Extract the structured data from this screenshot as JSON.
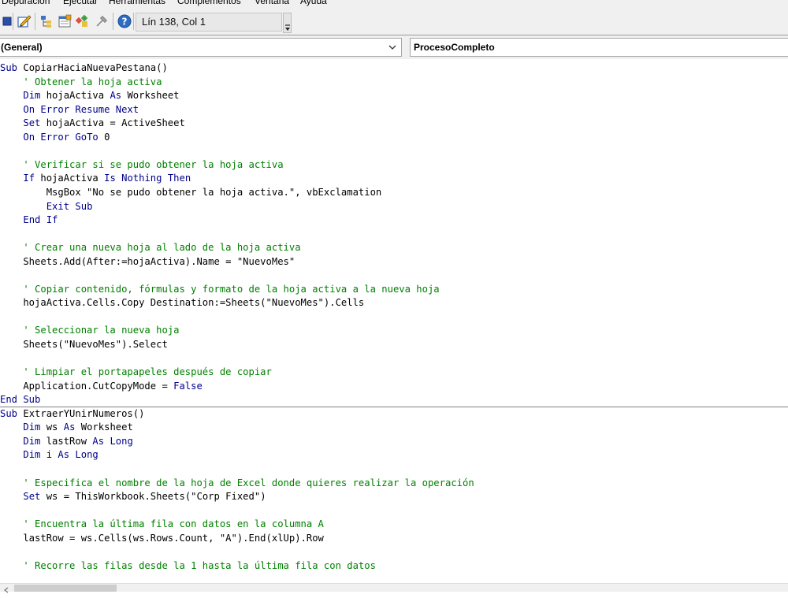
{
  "menu": {
    "items": [
      "Depuración",
      "Ejecutar",
      "Herramientas",
      "Complementos",
      "Ventana",
      "Ayuda"
    ]
  },
  "toolbar": {
    "position": "Lín 138, Col 1",
    "icons": [
      "stop-icon",
      "design-mode-icon",
      "project-explorer-icon",
      "properties-icon",
      "object-browser-icon",
      "toolbox-icon",
      "help-icon"
    ]
  },
  "combos": {
    "object": "(General)",
    "procedure": "ProcesoCompleto"
  },
  "colors": {
    "keyword": "#00008b",
    "comment": "#008000",
    "text": "#000000"
  },
  "code": {
    "lines": [
      [
        {
          "t": "Sub",
          "c": "kw"
        },
        {
          "t": " CopiarHaciaNuevaPestana()"
        }
      ],
      [
        {
          "t": "    ' Obtener la hoja activa",
          "c": "cm"
        }
      ],
      [
        {
          "t": "    "
        },
        {
          "t": "Dim",
          "c": "kw"
        },
        {
          "t": " hojaActiva "
        },
        {
          "t": "As",
          "c": "kw"
        },
        {
          "t": " Worksheet"
        }
      ],
      [
        {
          "t": "    "
        },
        {
          "t": "On Error Resume Next",
          "c": "kw"
        }
      ],
      [
        {
          "t": "    "
        },
        {
          "t": "Set",
          "c": "kw"
        },
        {
          "t": " hojaActiva = ActiveSheet"
        }
      ],
      [
        {
          "t": "    "
        },
        {
          "t": "On Error GoTo",
          "c": "kw"
        },
        {
          "t": " 0"
        }
      ],
      [],
      [
        {
          "t": "    ' Verificar si se pudo obtener la hoja activa",
          "c": "cm"
        }
      ],
      [
        {
          "t": "    "
        },
        {
          "t": "If",
          "c": "kw"
        },
        {
          "t": " hojaActiva "
        },
        {
          "t": "Is Nothing Then",
          "c": "kw"
        }
      ],
      [
        {
          "t": "        MsgBox \"No se pudo obtener la hoja activa.\", vbExclamation"
        }
      ],
      [
        {
          "t": "        "
        },
        {
          "t": "Exit Sub",
          "c": "kw"
        }
      ],
      [
        {
          "t": "    "
        },
        {
          "t": "End If",
          "c": "kw"
        }
      ],
      [],
      [
        {
          "t": "    ' Crear una nueva hoja al lado de la hoja activa",
          "c": "cm"
        }
      ],
      [
        {
          "t": "    Sheets.Add(After:=hojaActiva).Name = \"NuevoMes\""
        }
      ],
      [],
      [
        {
          "t": "    ' Copiar contenido, fórmulas y formato de la hoja activa a la nueva hoja",
          "c": "cm"
        }
      ],
      [
        {
          "t": "    hojaActiva.Cells.Copy Destination:=Sheets(\"NuevoMes\").Cells"
        }
      ],
      [],
      [
        {
          "t": "    ' Seleccionar la nueva hoja",
          "c": "cm"
        }
      ],
      [
        {
          "t": "    Sheets(\"NuevoMes\").Select"
        }
      ],
      [],
      [
        {
          "t": "    ' Limpiar el portapapeles después de copiar",
          "c": "cm"
        }
      ],
      [
        {
          "t": "    Application.CutCopyMode = "
        },
        {
          "t": "False",
          "c": "kw"
        }
      ],
      [
        {
          "t": "End Sub",
          "c": "kw"
        }
      ],
      [
        {
          "t": "Sub",
          "c": "kw"
        },
        {
          "t": " ExtraerYUnirNumeros()"
        }
      ],
      [
        {
          "t": "    "
        },
        {
          "t": "Dim",
          "c": "kw"
        },
        {
          "t": " ws "
        },
        {
          "t": "As",
          "c": "kw"
        },
        {
          "t": " Worksheet"
        }
      ],
      [
        {
          "t": "    "
        },
        {
          "t": "Dim",
          "c": "kw"
        },
        {
          "t": " lastRow "
        },
        {
          "t": "As",
          "c": "kw"
        },
        {
          "t": " "
        },
        {
          "t": "Long",
          "c": "kw"
        }
      ],
      [
        {
          "t": "    "
        },
        {
          "t": "Dim",
          "c": "kw"
        },
        {
          "t": " i "
        },
        {
          "t": "As",
          "c": "kw"
        },
        {
          "t": " "
        },
        {
          "t": "Long",
          "c": "kw"
        }
      ],
      [],
      [
        {
          "t": "    ' Especifica el nombre de la hoja de Excel donde quieres realizar la operación",
          "c": "cm"
        }
      ],
      [
        {
          "t": "    "
        },
        {
          "t": "Set",
          "c": "kw"
        },
        {
          "t": " ws = ThisWorkbook.Sheets(\"Corp Fixed\")"
        }
      ],
      [],
      [
        {
          "t": "    ' Encuentra la última fila con datos en la columna A",
          "c": "cm"
        }
      ],
      [
        {
          "t": "    lastRow = ws.Cells(ws.Rows.Count, \"A\").End(xlUp).Row"
        }
      ],
      [],
      [
        {
          "t": "    ' Recorre las filas desde la 1 hasta la última fila con datos",
          "c": "cm"
        }
      ]
    ]
  }
}
